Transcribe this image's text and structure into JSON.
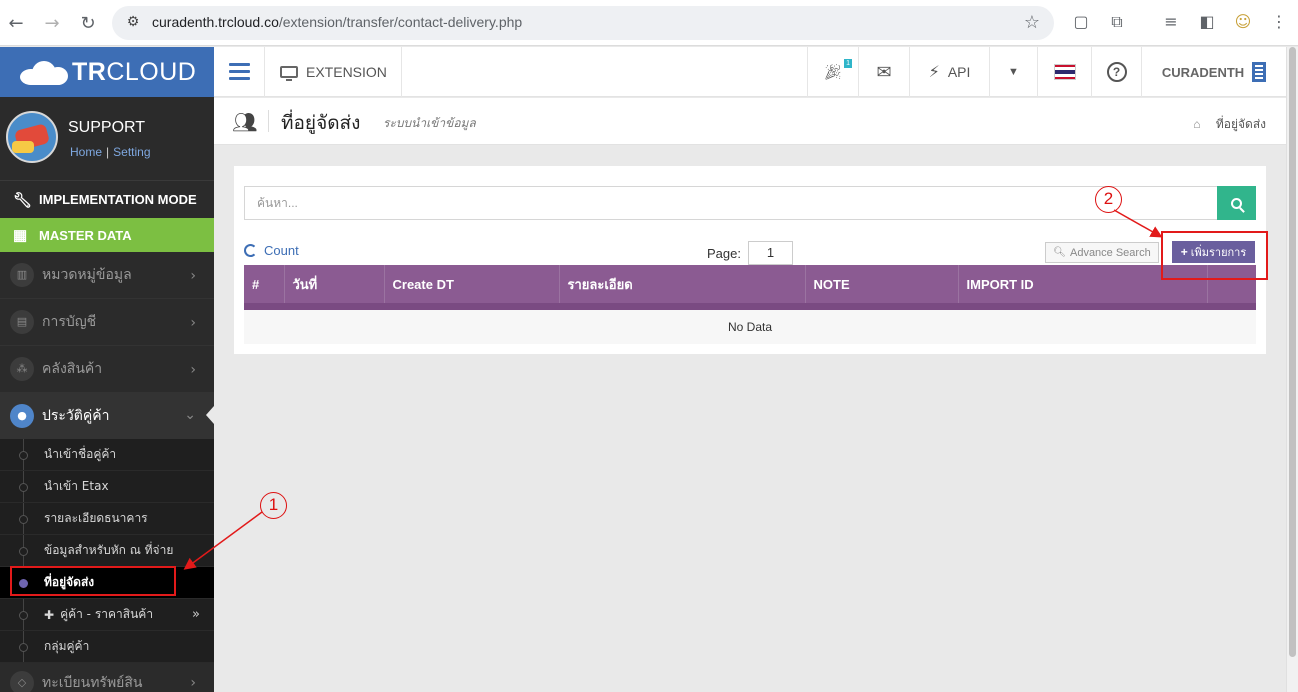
{
  "browser": {
    "url_domain": "curadenth.trcloud.co",
    "url_path": "/extension/transfer/contact-delivery.php"
  },
  "sidebar": {
    "brand_tr": "TR",
    "brand_cloud": "CLOUD",
    "profile_name": "SUPPORT",
    "link_home": "Home",
    "link_sep": "|",
    "link_setting": "Setting",
    "implementation": "IMPLEMENTATION MODE",
    "master": "MASTER DATA",
    "items": [
      {
        "label": "หมวดหมู่ข้อมูล"
      },
      {
        "label": "การบัญชี"
      },
      {
        "label": "คลังสินค้า"
      },
      {
        "label": "ประวัติคู่ค้า"
      }
    ],
    "sub": [
      {
        "label": "นำเข้าชื่อคู่ค้า"
      },
      {
        "label": "นำเข้า Etax"
      },
      {
        "label": "รายละเอียดธนาคาร"
      },
      {
        "label": "ข้อมูลสำหรับหัก ณ ที่จ่าย"
      },
      {
        "label": "ที่อยู่จัดส่ง"
      },
      {
        "label": "คู่ค้า - ราคาสินค้า"
      },
      {
        "label": "กลุ่มคู่ค้า"
      }
    ],
    "last_item": "ทะเบียนทรัพย์สิน"
  },
  "topbar": {
    "extension": "EXTENSION",
    "badge": "1",
    "api": "API",
    "company": "CURADENTH"
  },
  "page": {
    "title": "ที่อยู่จัดส่ง",
    "subtitle": "ระบบนำเข้าข้อมูล",
    "breadcrumb": "ที่อยู่จัดส่ง"
  },
  "panel": {
    "search_placeholder": "ค้นหา...",
    "count": "Count",
    "page_label": "Page:",
    "page_value": "1",
    "advance_search": "Advance Search",
    "add_button": "เพิ่มรายการ",
    "columns": [
      "#",
      "วันที่",
      "Create DT",
      "รายละเอียด",
      "NOTE",
      "IMPORT ID",
      ""
    ],
    "no_data": "No Data"
  },
  "annotations": {
    "one": "1",
    "two": "2"
  },
  "colors": {
    "accent_blue": "#3d6eb5",
    "master_green": "#7cbf42",
    "table_header": "#8b5b92",
    "add_button": "#6a5f9e",
    "search_button": "#31b58c",
    "annotation_red": "#e21a1a"
  }
}
